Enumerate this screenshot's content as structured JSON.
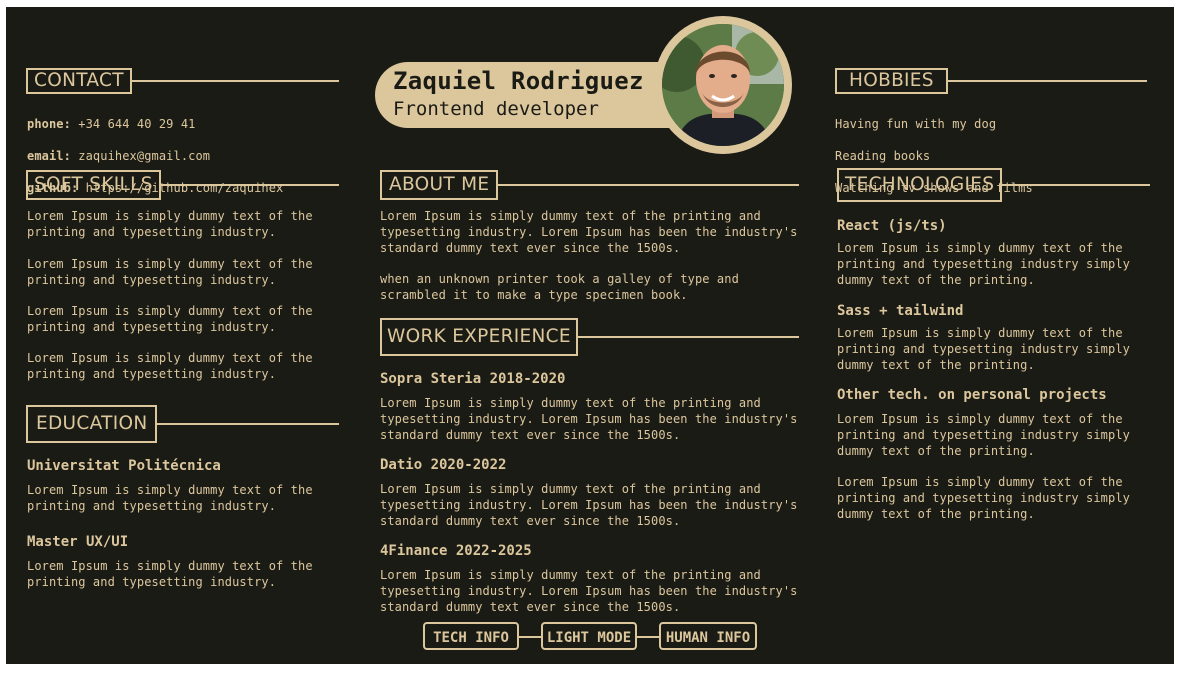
{
  "profile": {
    "name": "Zaquiel Rodriguez",
    "role": "Frontend developer"
  },
  "contact": {
    "heading": "CONTACT",
    "phone_label": "phone:",
    "phone": "+34 644 40 29 41",
    "email_label": "email:",
    "email": "zaquihex@gmail.com",
    "github_label": "github:",
    "github": "https://github.com/zaquihex"
  },
  "soft_skills": {
    "heading": "SOFT SKILLS",
    "items": [
      "Lorem Ipsum is simply dummy text of the\nprinting and typesetting industry.",
      "Lorem Ipsum is simply dummy text of the\nprinting and typesetting industry.",
      "Lorem Ipsum is simply dummy text of the\nprinting and typesetting industry.",
      "Lorem Ipsum is simply dummy text of the\nprinting and typesetting industry."
    ]
  },
  "education": {
    "heading": "EDUCATION",
    "items": [
      {
        "title": "Universitat Politécnica",
        "text": "Lorem Ipsum is simply dummy text of the\nprinting and typesetting industry."
      },
      {
        "title": "Master UX/UI",
        "text": "Lorem Ipsum is simply dummy text of the\nprinting and typesetting industry."
      }
    ]
  },
  "about": {
    "heading": "ABOUT ME",
    "p1": "Lorem Ipsum is simply dummy text of the printing and\ntypesetting industry. Lorem Ipsum has been the industry's\nstandard dummy text ever since the 1500s.",
    "p2": "when an unknown printer took a galley of type and\nscrambled it to make a type specimen book."
  },
  "work": {
    "heading": "WORK EXPERIENCE",
    "items": [
      {
        "title": "Sopra Steria 2018-2020",
        "text": "Lorem Ipsum is simply dummy text of the printing and\ntypesetting industry. Lorem Ipsum has been the industry's\nstandard dummy text ever since the 1500s."
      },
      {
        "title": "Datio 2020-2022",
        "text": "Lorem Ipsum is simply dummy text of the printing and\ntypesetting industry. Lorem Ipsum has been the industry's\nstandard dummy text ever since the 1500s."
      },
      {
        "title": "4Finance 2022-2025",
        "text": "Lorem Ipsum is simply dummy text of the printing and\ntypesetting industry. Lorem Ipsum has been the industry's\nstandard dummy text ever since the 1500s."
      }
    ]
  },
  "hobbies": {
    "heading": "HOBBIES",
    "items": [
      "Having fun with my dog",
      "Reading books",
      "Watching tv shows and films"
    ]
  },
  "technologies": {
    "heading": "TECHNOLOGIES",
    "items": [
      {
        "title": "React (js/ts)",
        "text": "Lorem Ipsum is simply dummy text of the\nprinting and typesetting industry simply\ndummy text of the printing."
      },
      {
        "title": "Sass + tailwind",
        "text": "Lorem Ipsum is simply dummy text of the\nprinting and typesetting industry simply\ndummy text of the printing."
      },
      {
        "title": "Other tech. on personal projects",
        "text": "Lorem Ipsum is simply dummy text of the\nprinting and typesetting industry simply\ndummy text of the printing."
      }
    ],
    "extra": "Lorem Ipsum is simply dummy text of the\nprinting and typesetting industry simply\ndummy text of the printing."
  },
  "footer": {
    "tech_info": "TECH INFO",
    "light_mode": "LIGHT MODE",
    "human_info": "HUMAN INFO"
  },
  "colors": {
    "background": "#1b1b16",
    "accent": "#dcc79d"
  }
}
